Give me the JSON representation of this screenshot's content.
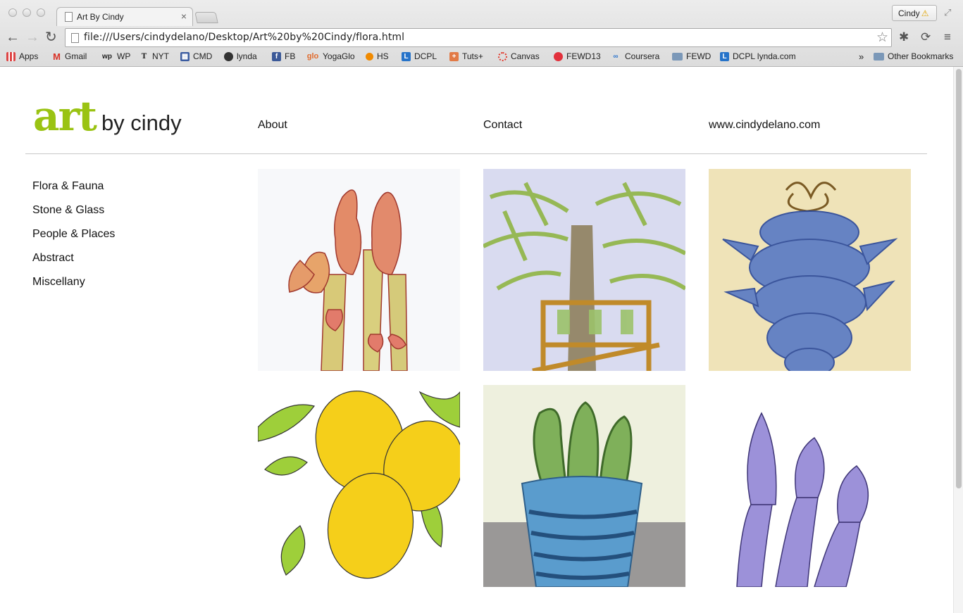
{
  "browser": {
    "tab_title": "Art By Cindy",
    "tab_close": "×",
    "profile_name": "Cindy",
    "url": "file:///Users/cindydelano/Desktop/Art%20by%20Cindy/flora.html",
    "bookmarks": [
      {
        "label": "Apps",
        "icon": "apps-grid-icon",
        "color": "#d44"
      },
      {
        "label": "Gmail",
        "icon": "gmail-icon",
        "color": "#d93025"
      },
      {
        "label": "WP",
        "icon": "washington-post-icon",
        "color": "#222"
      },
      {
        "label": "NYT",
        "icon": "nyt-icon",
        "color": "#222"
      },
      {
        "label": "CMD",
        "icon": "calendar-grid-icon",
        "color": "#3a5ba0"
      },
      {
        "label": "lynda",
        "icon": "lynda-icon",
        "color": "#333"
      },
      {
        "label": "FB",
        "icon": "facebook-icon",
        "color": "#3b5998"
      },
      {
        "label": "YogaGlo",
        "icon": "yogaglo-icon",
        "color": "#e06a2c"
      },
      {
        "label": "HS",
        "icon": "hs-dot-icon",
        "color": "#f08a00"
      },
      {
        "label": "DCPL",
        "icon": "dcpl-icon",
        "color": "#2673c9"
      },
      {
        "label": "Tuts+",
        "icon": "tuts-icon",
        "color": "#e27a46"
      },
      {
        "label": "Canvas",
        "icon": "canvas-icon",
        "color": "#e23b2e"
      },
      {
        "label": "FEWD13",
        "icon": "fewd13-icon",
        "color": "#e2313c"
      },
      {
        "label": "Coursera",
        "icon": "coursera-icon",
        "color": "#2a73cc"
      },
      {
        "label": "FEWD",
        "icon": "folder-icon",
        "color": "#7b98b8"
      },
      {
        "label": "DCPL lynda.com",
        "icon": "dcpl-lynda-icon",
        "color": "#2673c9"
      }
    ],
    "overflow_label": "»",
    "other_bookmarks": "Other Bookmarks"
  },
  "site": {
    "logo_art": "art",
    "logo_by": "by cindy",
    "topnav": [
      "About",
      "Contact",
      "www.cindydelano.com"
    ],
    "sidenav": [
      "Flora & Fauna",
      "Stone & Glass",
      "People & Places",
      "Abstract",
      "Miscellany"
    ]
  },
  "gallery": [
    {
      "subject": "asparagus-red-painting"
    },
    {
      "subject": "tree-bench-painting"
    },
    {
      "subject": "blue-chili-ristra-painting"
    },
    {
      "subject": "lemons-painting"
    },
    {
      "subject": "cactus-pot-painting"
    },
    {
      "subject": "asparagus-purple-painting"
    }
  ]
}
